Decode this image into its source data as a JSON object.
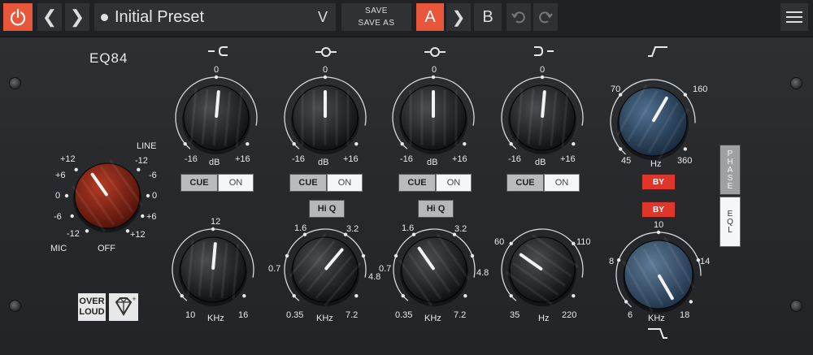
{
  "topbar": {
    "preset_name": "Initial Preset",
    "save_label": "SAVE",
    "save_as_label": "SAVE AS",
    "a_label": "A",
    "b_label": "B",
    "prev_glyph": "❮",
    "next_glyph": "❯",
    "copy_glyph": "❯",
    "dropdown_glyph": "V"
  },
  "colors": {
    "accent": "#e8573a",
    "bypass_red": "#e0352b",
    "panel": "#2b2d30"
  },
  "plugin": {
    "title": "EQ84",
    "brand_line1": "OVER",
    "brand_line2": "LOUD"
  },
  "input": {
    "labels": {
      "line": "LINE",
      "mic": "MIC",
      "off": "OFF",
      "p12l": "+12",
      "p6l": "+6",
      "zl": "0",
      "m6l": "-6",
      "m12l": "-12",
      "m12r": "-12",
      "m6r": "-6",
      "zr": "0",
      "p6r": "+6",
      "p12r": "+12"
    }
  },
  "bands": [
    {
      "gain_labels": {
        "top": "0",
        "min": "-16",
        "unit": "dB",
        "max": "+16"
      },
      "cue": "CUE",
      "on": "ON",
      "freq_labels": {
        "top": "12",
        "min": "10",
        "unit": "KHz",
        "max": "16"
      }
    },
    {
      "gain_labels": {
        "top": "0",
        "min": "-16",
        "unit": "dB",
        "max": "+16"
      },
      "cue": "CUE",
      "on": "ON",
      "hiq": "Hi Q",
      "freq_labels": {
        "a": "1.6",
        "b": "3.2",
        "c": "0.7",
        "d": "4.8",
        "min": "0.35",
        "unit": "KHz",
        "max": "7.2"
      }
    },
    {
      "gain_labels": {
        "top": "0",
        "min": "-16",
        "unit": "dB",
        "max": "+16"
      },
      "cue": "CUE",
      "on": "ON",
      "hiq": "Hi Q",
      "freq_labels": {
        "a": "1.6",
        "b": "3.2",
        "c": "0.7",
        "d": "4.8",
        "min": "0.35",
        "unit": "KHz",
        "max": "7.2"
      }
    },
    {
      "gain_labels": {
        "top": "0",
        "min": "-16",
        "unit": "dB",
        "max": "+16"
      },
      "cue": "CUE",
      "on": "ON",
      "freq_labels": {
        "a": "60",
        "b": "110",
        "min": "35",
        "unit": "Hz",
        "max": "220"
      }
    }
  ],
  "filters": {
    "hpf_labels": {
      "a": "70",
      "b": "160",
      "min": "45",
      "unit": "Hz",
      "max": "360"
    },
    "lpf_labels": {
      "top": "10",
      "l": "8",
      "r": "14",
      "min": "6",
      "unit": "KHz",
      "max": "18"
    },
    "by1": "BY",
    "by2": "BY",
    "phase": "PHASE",
    "eql": "EQL"
  }
}
